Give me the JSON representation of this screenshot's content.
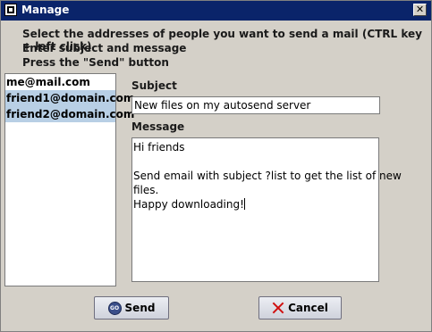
{
  "window": {
    "title": "Manage"
  },
  "instructions": [
    "Select the addresses of people you want to send a mail (CTRL key + left click)",
    "Enter subject and message",
    "Press the \"Send\" button"
  ],
  "addresses": [
    {
      "email": "me@mail.com",
      "selected": false
    },
    {
      "email": "friend1@domain.com",
      "selected": true
    },
    {
      "email": "friend2@domain.com",
      "selected": true
    }
  ],
  "subject": {
    "label": "Subject",
    "value": "New files on my autosend server"
  },
  "message": {
    "label": "Message",
    "lines": [
      "Hi friends",
      "",
      "Send email with subject ?list to get the list of new",
      "files.",
      "Happy downloading!"
    ]
  },
  "buttons": {
    "send_label": "Send",
    "send_icon_text": "GO",
    "cancel_label": "Cancel"
  },
  "colors": {
    "titlebar": "#0a246a",
    "selection": "#b8cfe5",
    "cancel_icon": "#d01010"
  }
}
